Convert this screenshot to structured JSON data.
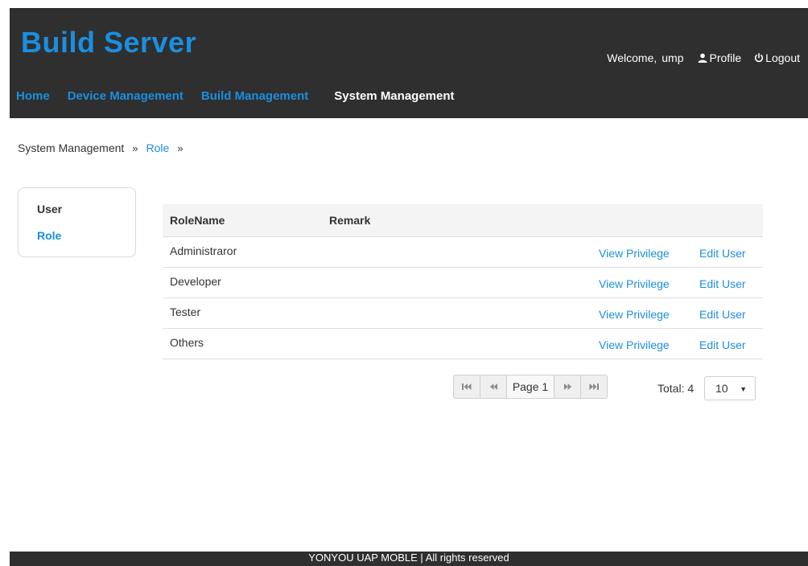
{
  "header": {
    "brand": "Build Server",
    "welcome": "Welcome,",
    "username": "ump",
    "profile_label": "Profile",
    "logout_label": "Logout"
  },
  "nav": {
    "items": [
      "Home",
      "Device Management",
      "Build Management",
      "System Management"
    ],
    "active": "System Management"
  },
  "breadcrumb": {
    "root": "System Management",
    "current": "Role",
    "separator": "»"
  },
  "sidebar": {
    "items": [
      "User",
      "Role"
    ],
    "active": "Role"
  },
  "table": {
    "columns": [
      "RoleName",
      "Remark"
    ],
    "rows": [
      {
        "name": "Administraror",
        "remark": "",
        "view": "View Privilege",
        "edit": "Edit User"
      },
      {
        "name": "Developer",
        "remark": "",
        "view": "View Privilege",
        "edit": "Edit User"
      },
      {
        "name": "Tester",
        "remark": "",
        "view": "View Privilege",
        "edit": "Edit User"
      },
      {
        "name": "Others",
        "remark": "",
        "view": "View Privilege",
        "edit": "Edit User"
      }
    ]
  },
  "pagination": {
    "page_label": "Page 1",
    "total_label": "Total: 4",
    "page_size": "10"
  },
  "footer": {
    "text": "YONYOU UAP MOBLE | All rights reserved"
  },
  "colors": {
    "accent": "#1a8fe0",
    "header_bg": "#2f2f2f"
  }
}
